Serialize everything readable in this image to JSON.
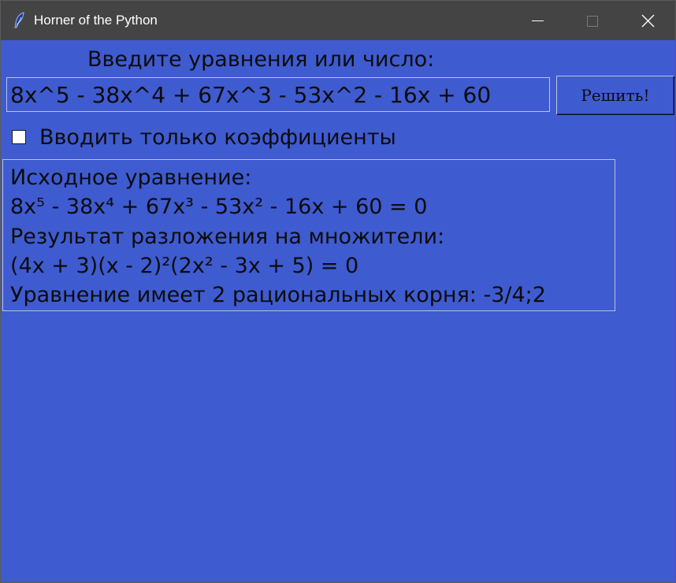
{
  "window": {
    "title": "Horner of the Python",
    "app_icon": "feather-icon",
    "controls": {
      "minimize_icon": "minimize-icon",
      "maximize_icon": "maximize-icon",
      "close_icon": "close-icon"
    }
  },
  "form": {
    "prompt_label": "Введите уравнения или число:",
    "equation_value": "8x^5 - 38x^4 + 67x^3 - 53x^2 - 16x + 60",
    "solve_label": "Решить!",
    "coefficients_only_label": "Вводить только коэффициенты",
    "coefficients_only_checked": false
  },
  "result": {
    "lines": [
      "Исходное уравнение:",
      "8x⁵ - 38x⁴ + 67x³ - 53x² - 16x + 60 = 0",
      "Результат разложения на множители:",
      "(4x + 3)(x - 2)²(2x² - 3x + 5) = 0",
      "Уравнение имеет 2 рациональных корня: -3/4;2"
    ]
  },
  "colors": {
    "background": "#3f5bd0",
    "titlebar": "#444444",
    "text": "#0c0c0c"
  }
}
